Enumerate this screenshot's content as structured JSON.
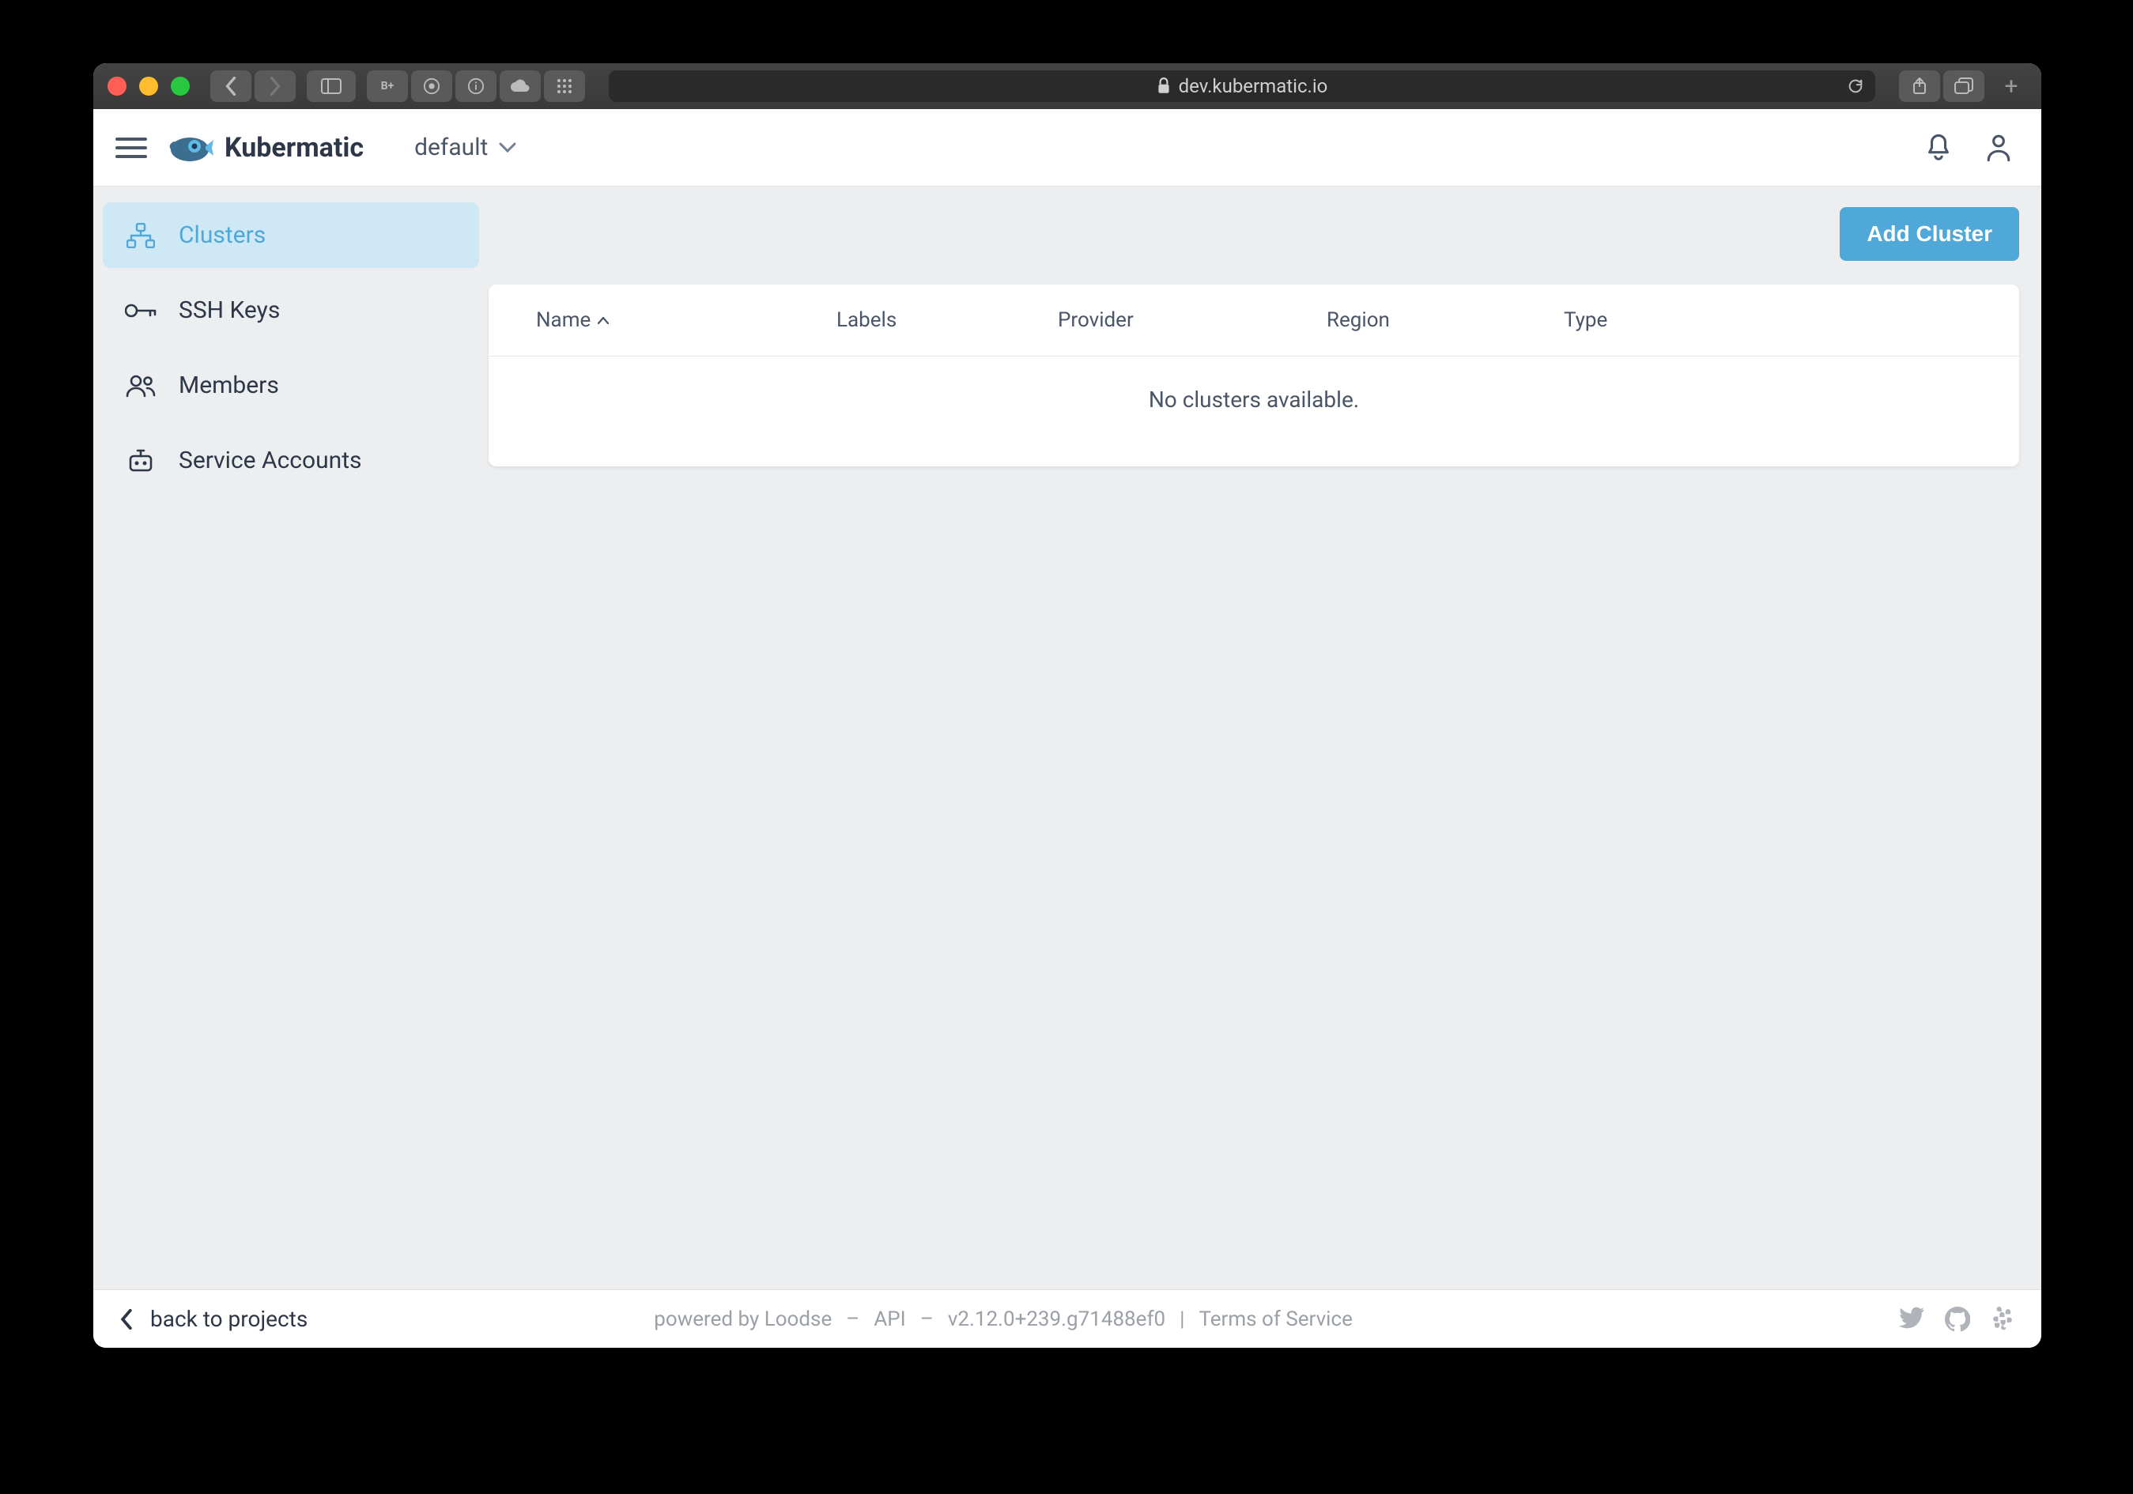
{
  "browser": {
    "url": "dev.kubermatic.io"
  },
  "header": {
    "brand": "Kubermatic",
    "project": "default"
  },
  "sidebar": {
    "items": [
      {
        "label": "Clusters",
        "icon": "sitemap-icon",
        "active": true
      },
      {
        "label": "SSH Keys",
        "icon": "key-icon",
        "active": false
      },
      {
        "label": "Members",
        "icon": "people-icon",
        "active": false
      },
      {
        "label": "Service Accounts",
        "icon": "robot-icon",
        "active": false
      }
    ]
  },
  "main": {
    "add_button": "Add Cluster",
    "columns": {
      "name": "Name",
      "labels": "Labels",
      "provider": "Provider",
      "region": "Region",
      "type": "Type"
    },
    "empty_message": "No clusters available."
  },
  "footer": {
    "back": "back to projects",
    "powered": "powered by Loodse",
    "api": "API",
    "version": "v2.12.0+239.g71488ef0",
    "tos": "Terms of Service"
  }
}
